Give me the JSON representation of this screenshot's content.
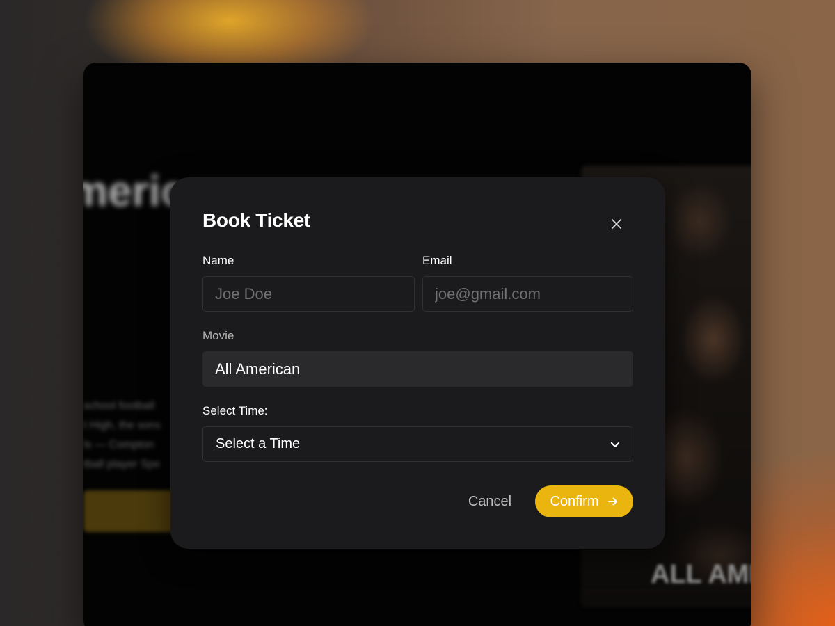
{
  "background_app": {
    "title_fragment": "merica",
    "description_lines": [
      "school football",
      "t High, the sons",
      "ls — Compton",
      "tball player Spe"
    ],
    "poster_text": "ALL AMER"
  },
  "modal": {
    "title": "Book Ticket",
    "close_icon": "close-icon",
    "name_label": "Name",
    "name_placeholder": "Joe Doe",
    "email_label": "Email",
    "email_placeholder": "joe@gmail.com",
    "movie_label": "Movie",
    "movie_value": "All American",
    "time_label": "Select Time:",
    "time_selected": "Select a Time",
    "time_icon": "chevron-down-icon",
    "cancel_label": "Cancel",
    "confirm_label": "Confirm",
    "confirm_icon": "arrow-right-icon"
  },
  "colors": {
    "accent": "#e9b50e",
    "modal_bg": "#1b1b1d",
    "input_border": "#303033",
    "movie_bg": "#2a2a2d"
  }
}
